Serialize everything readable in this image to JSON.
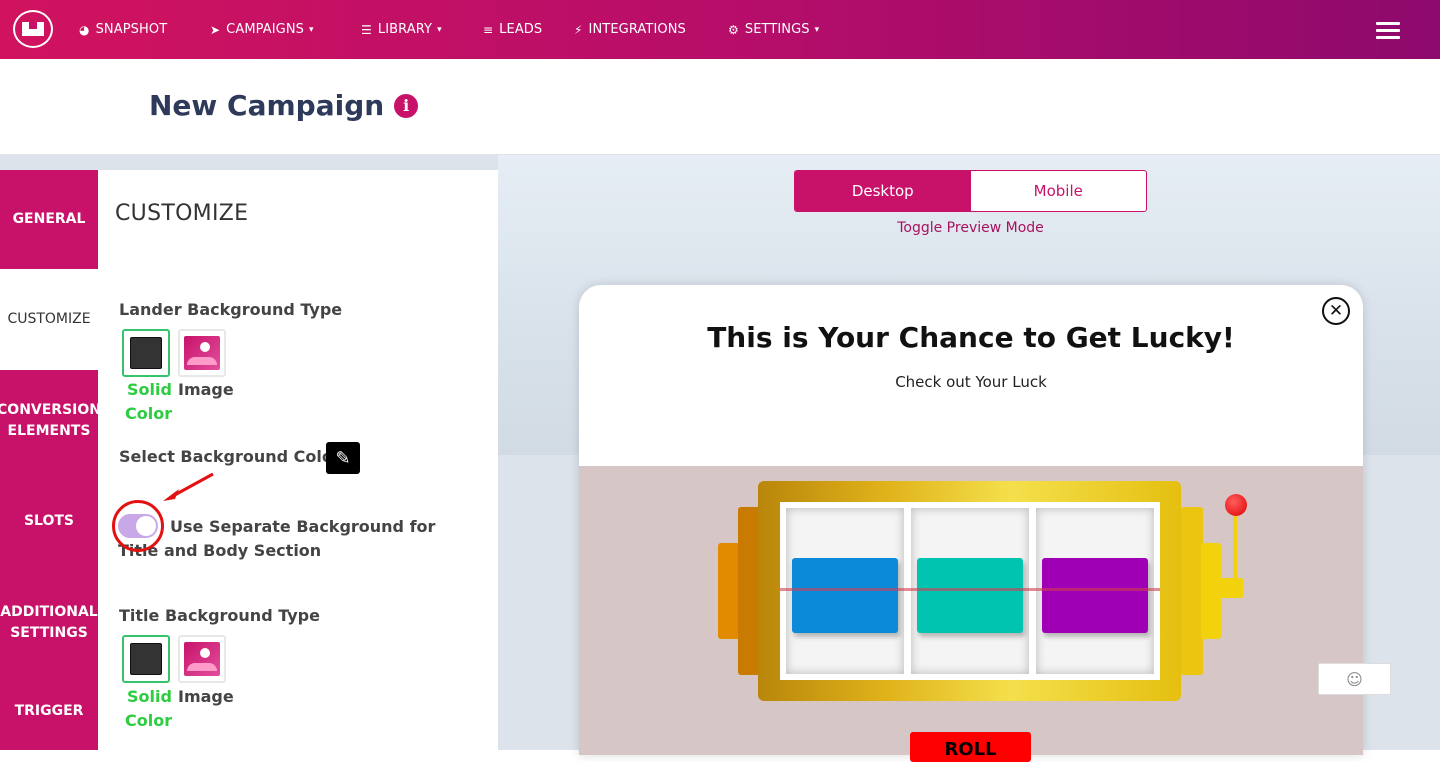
{
  "navbar": {
    "items": [
      {
        "label": "SNAPSHOT",
        "icon": "dashboard-icon",
        "glyph": "◕"
      },
      {
        "label": "CAMPAIGNS",
        "icon": "paper-plane-icon",
        "glyph": "➤"
      },
      {
        "label": "LIBRARY",
        "icon": "list-icon",
        "glyph": "☰"
      },
      {
        "label": "LEADS",
        "icon": "list-icon",
        "glyph": "≡"
      },
      {
        "label": "INTEGRATIONS",
        "icon": "plug-icon",
        "glyph": "⚡"
      },
      {
        "label": "SETTINGS",
        "icon": "gears-icon",
        "glyph": "⚙"
      }
    ],
    "caret": "▾"
  },
  "header": {
    "title": "New Campaign",
    "info_glyph": "i"
  },
  "tabs": [
    {
      "label": "GENERAL"
    },
    {
      "label": "CUSTOMIZE"
    },
    {
      "label": "CONVERSION ELEMENTS"
    },
    {
      "label": "SLOTS"
    },
    {
      "label": "ADDITIONAL SETTINGS"
    },
    {
      "label": "TRIGGER"
    }
  ],
  "panel": {
    "title": "CUSTOMIZE",
    "lander_bg_label": "Lander Background Type",
    "solid_line1": "Solid",
    "solid_line2": "Color",
    "image_label": "Image",
    "select_bg_label": "Select Background Color",
    "separate_bg_label": "Use Separate Background for Title and Body Section",
    "title_bg_label": "Title Background Type"
  },
  "preview": {
    "desktop_label": "Desktop",
    "mobile_label": "Mobile",
    "caption": "Toggle Preview Mode",
    "popup_title": "This is Your Chance to Get Lucky!",
    "popup_subtitle": "Check out Your Luck",
    "close_glyph": "✕",
    "spin_label": "ROLL",
    "reel_colors": [
      "#0a8ad9",
      "#00c4b0",
      "#9f00b5"
    ]
  },
  "emoji_button": {
    "glyph": "☺"
  },
  "colors": {
    "brand": "#c8126a",
    "selected": "#35c46b",
    "annotation": "#e31111"
  }
}
